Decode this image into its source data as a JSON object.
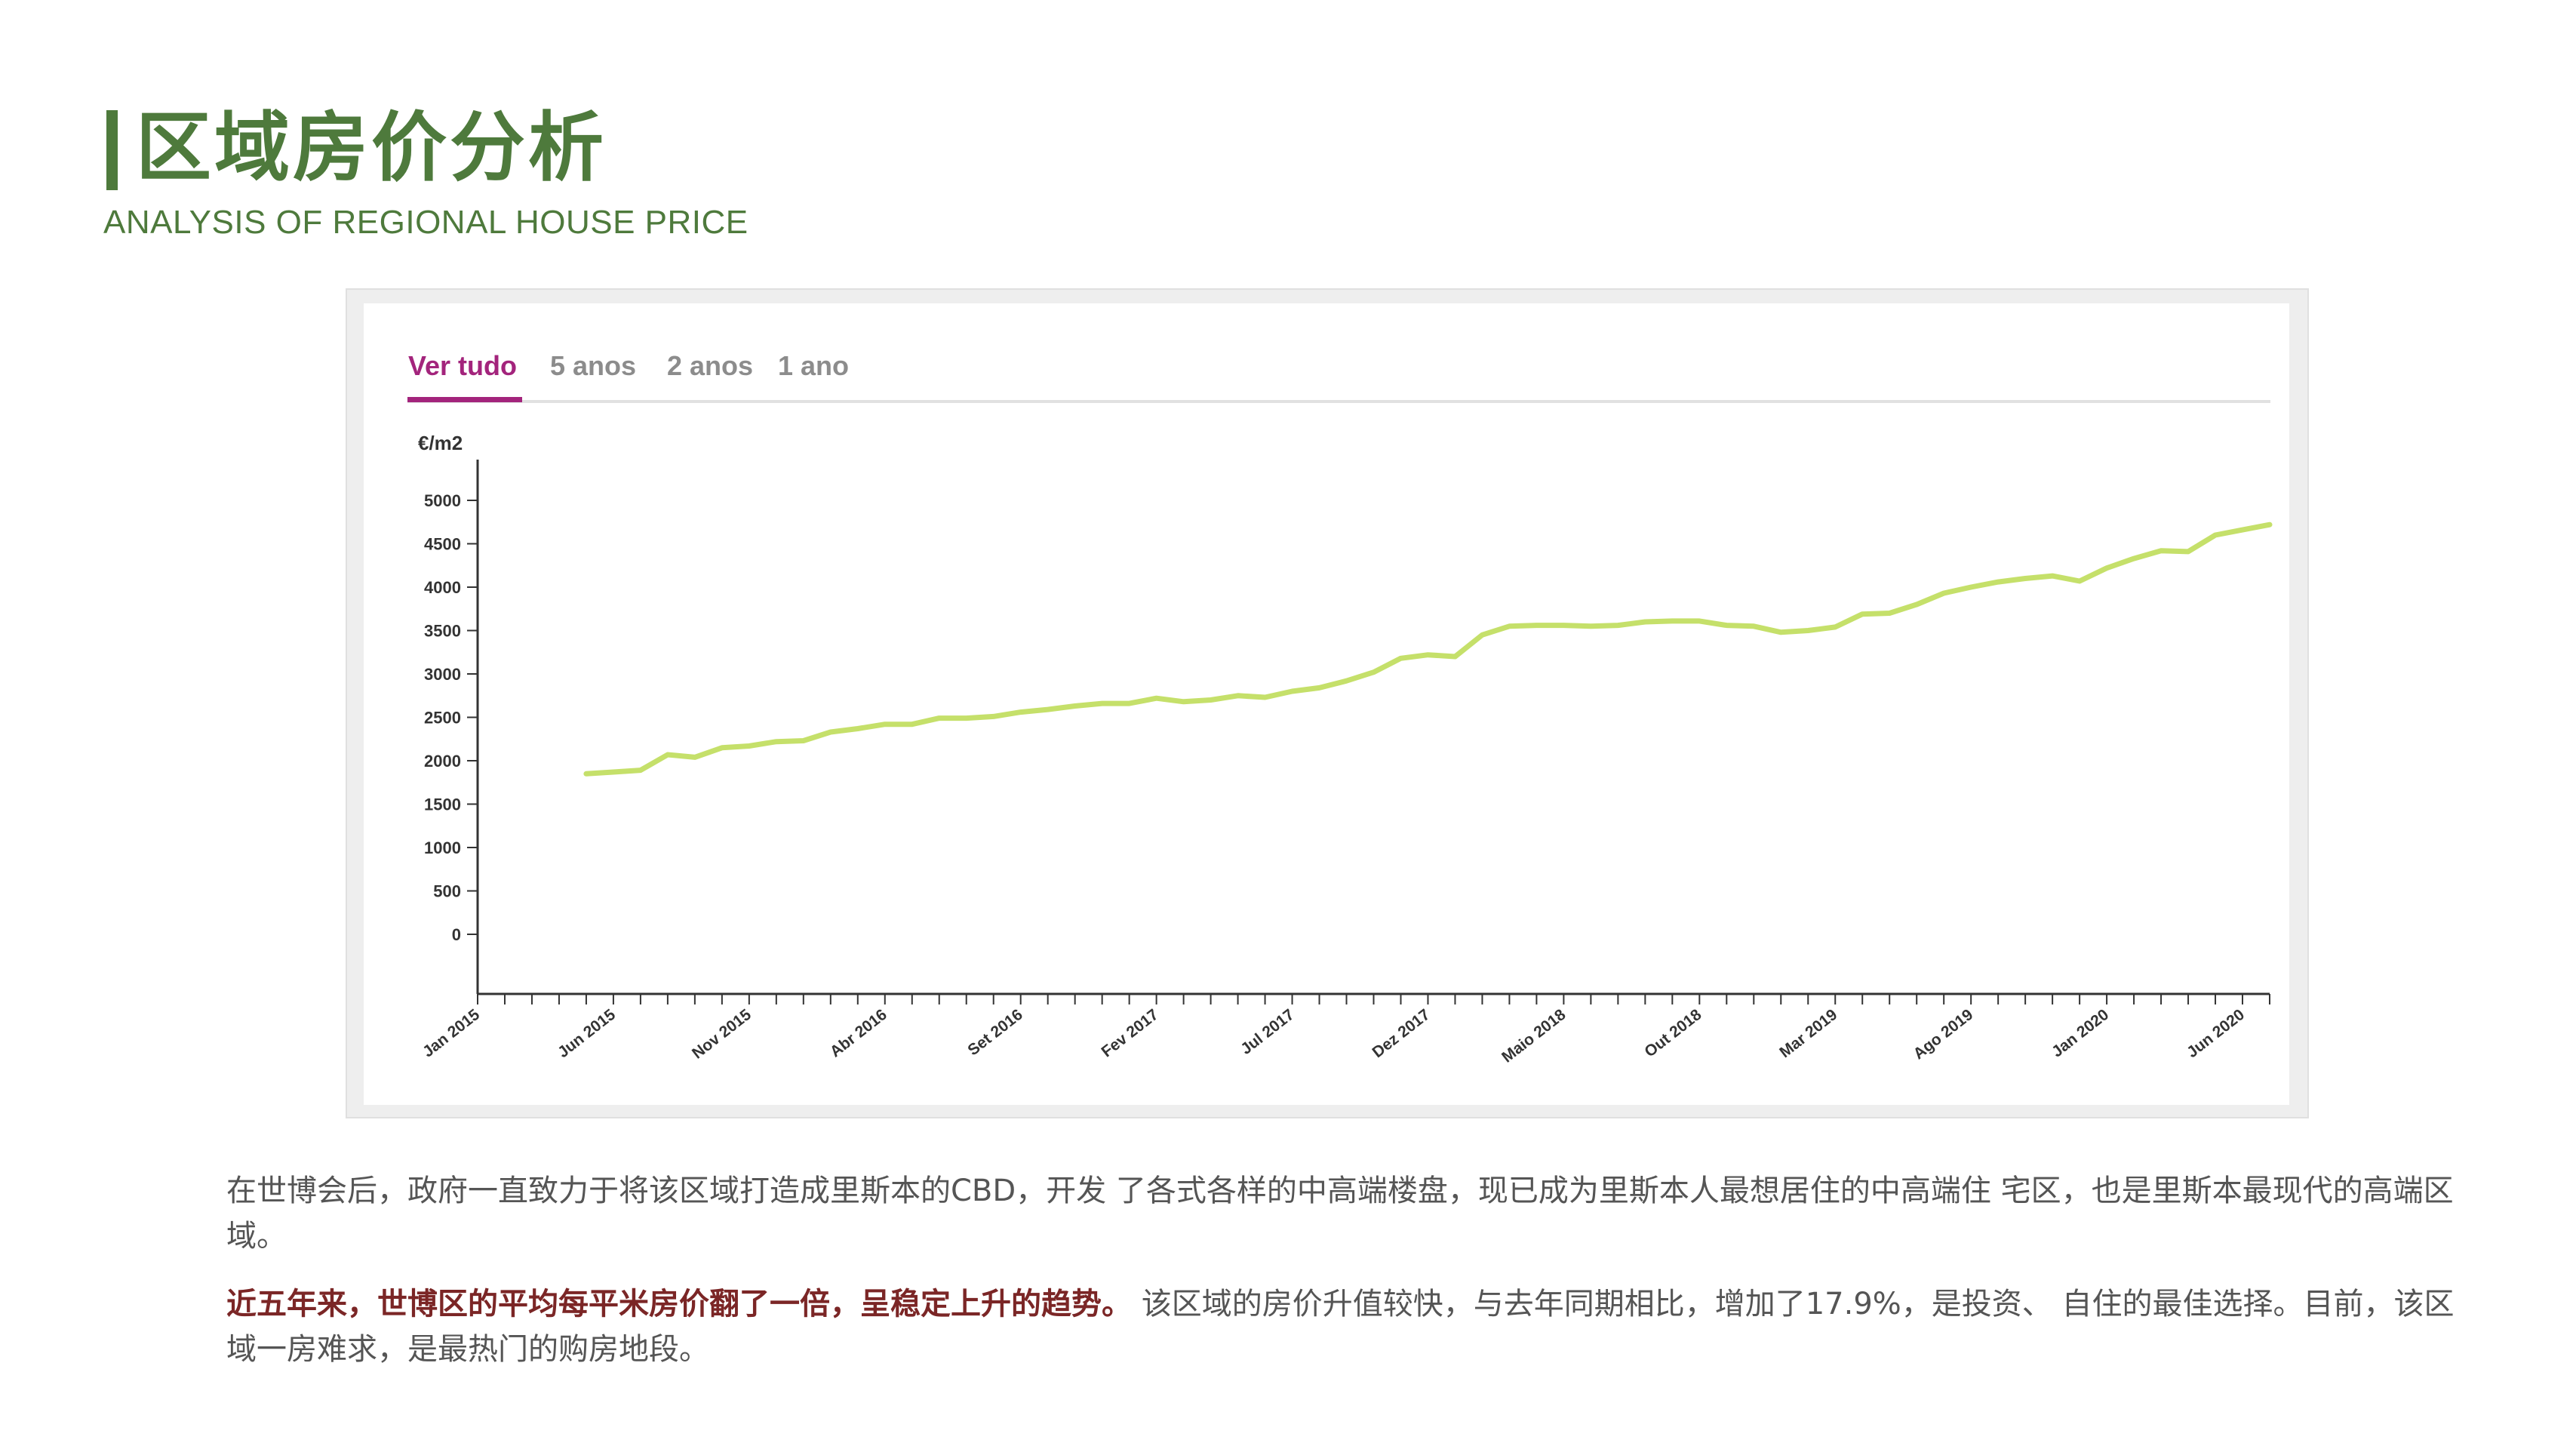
{
  "header": {
    "title": "区域房价分析",
    "subtitle": "ANALYSIS OF REGIONAL HOUSE PRICE",
    "accent_color": "#4e7a3c"
  },
  "tabs": [
    {
      "label": "Ver tudo",
      "active": true
    },
    {
      "label": "5 anos",
      "active": false
    },
    {
      "label": "2 anos",
      "active": false
    },
    {
      "label": "1 ano",
      "active": false
    }
  ],
  "chart_data": {
    "type": "line",
    "ylabel": "€/m2",
    "ylim": [
      0,
      5000
    ],
    "yticks": [
      0,
      500,
      1000,
      1500,
      2000,
      2500,
      3000,
      3500,
      4000,
      4500,
      5000
    ],
    "xlim": [
      "2015-01",
      "2020-07"
    ],
    "xtick_labels": [
      "Jan 2015",
      "Jun 2015",
      "Nov 2015",
      "Abr 2016",
      "Set 2016",
      "Fev 2017",
      "Jul 2017",
      "Dez 2017",
      "Maio 2018",
      "Out 2018",
      "Mar 2019",
      "Ago 2019",
      "Jan 2020",
      "Jun 2020"
    ],
    "line_color": "#c5e06a",
    "grid": false,
    "series": [
      {
        "x": [
          "2015-05",
          "2015-06",
          "2015-07",
          "2015-08",
          "2015-09",
          "2015-10",
          "2015-11",
          "2015-12",
          "2016-01",
          "2016-02",
          "2016-03",
          "2016-04",
          "2016-05",
          "2016-06",
          "2016-07",
          "2016-08",
          "2016-09",
          "2016-10",
          "2016-11",
          "2016-12",
          "2017-01",
          "2017-02",
          "2017-03",
          "2017-04",
          "2017-05",
          "2017-06",
          "2017-07",
          "2017-08",
          "2017-09",
          "2017-10",
          "2017-11",
          "2017-12",
          "2018-01",
          "2018-02",
          "2018-03",
          "2018-04",
          "2018-05",
          "2018-06",
          "2018-07",
          "2018-08",
          "2018-09",
          "2018-10",
          "2018-11",
          "2018-12",
          "2019-01",
          "2019-02",
          "2019-03",
          "2019-04",
          "2019-05",
          "2019-06",
          "2019-07",
          "2019-08",
          "2019-09",
          "2019-10",
          "2019-11",
          "2019-12",
          "2020-01",
          "2020-02",
          "2020-03",
          "2020-04",
          "2020-05",
          "2020-06",
          "2020-07"
        ],
        "values": [
          1850,
          1870,
          1890,
          2070,
          2040,
          2150,
          2170,
          2220,
          2230,
          2330,
          2370,
          2420,
          2420,
          2490,
          2490,
          2510,
          2560,
          2590,
          2630,
          2660,
          2660,
          2720,
          2680,
          2700,
          2750,
          2730,
          2800,
          2840,
          2920,
          3020,
          3180,
          3220,
          3200,
          3450,
          3550,
          3560,
          3560,
          3550,
          3560,
          3600,
          3610,
          3610,
          3560,
          3550,
          3480,
          3500,
          3540,
          3690,
          3700,
          3800,
          3930,
          4000,
          4060,
          4100,
          4130,
          4070,
          4220,
          4330,
          4420,
          4410,
          4600,
          4660,
          4720
        ]
      }
    ]
  },
  "body": {
    "para1": "在世博会后，政府一直致力于将该区域打造成里斯本的CBD，开发 了各式各样的中高端楼盘，现已成为里斯本人最想居住的中高端住 宅区，也是里斯本最现代的高端区域。",
    "para2_highlight": "近五年来，世博区的平均每平米房价翻了一倍，呈稳定上升的趋势。",
    "para2_rest": " 该区域的房价升值较快，与去年同期相比，增加了17.9%，是投资、 自住的最佳选择。目前，该区域一房难求，是最热门的购房地段。"
  }
}
